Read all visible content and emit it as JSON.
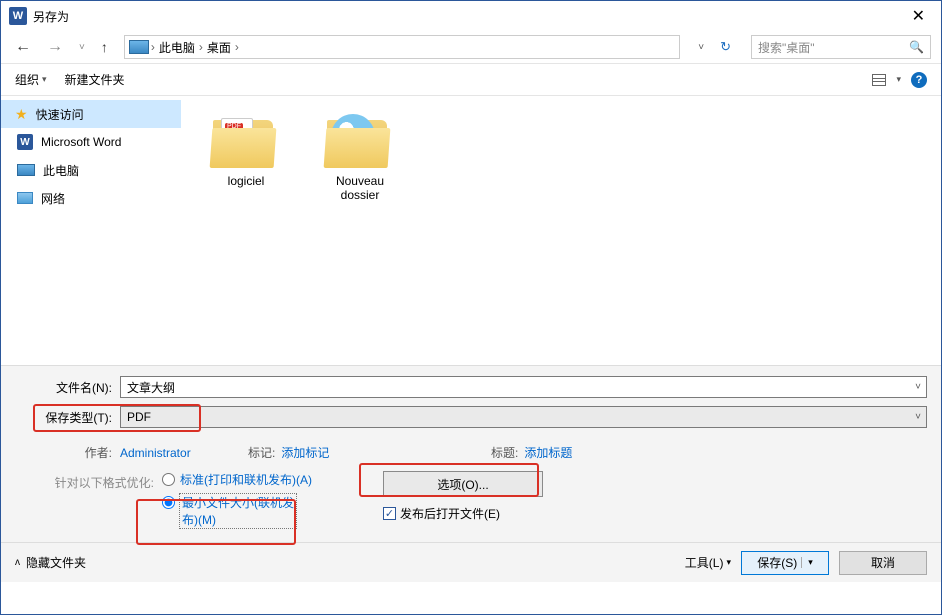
{
  "window": {
    "title": "另存为"
  },
  "breadcrumb": {
    "items": [
      "此电脑",
      "桌面"
    ]
  },
  "search": {
    "placeholder": "搜索\"桌面\""
  },
  "toolbar": {
    "organize": "组织",
    "new_folder": "新建文件夹"
  },
  "sidebar": {
    "items": [
      {
        "label": "快速访问"
      },
      {
        "label": "Microsoft Word"
      },
      {
        "label": "此电脑"
      },
      {
        "label": "网络"
      }
    ]
  },
  "folders": [
    {
      "label": "logiciel",
      "type": "pdf"
    },
    {
      "label": "Nouveau dossier",
      "type": "disc"
    }
  ],
  "form": {
    "filename_label": "文件名(N):",
    "filename_value": "文章大纲",
    "savetype_label": "保存类型(T):",
    "savetype_value": "PDF",
    "author_label": "作者:",
    "author_value": "Administrator",
    "tag_label": "标记:",
    "tag_value": "添加标记",
    "title_label": "标题:",
    "title_value": "添加标题",
    "optimize_label": "针对以下格式优化:",
    "radio_standard": "标准(打印和联机发布)(A)",
    "radio_min_a": "最小文件大小(联机发",
    "radio_min_b": "布)(M)",
    "options_button": "选项(O)...",
    "publish_after": "发布后打开文件(E)"
  },
  "footer": {
    "hide_folders": "隐藏文件夹",
    "tools": "工具(L)",
    "save": "保存(S)",
    "cancel": "取消"
  }
}
